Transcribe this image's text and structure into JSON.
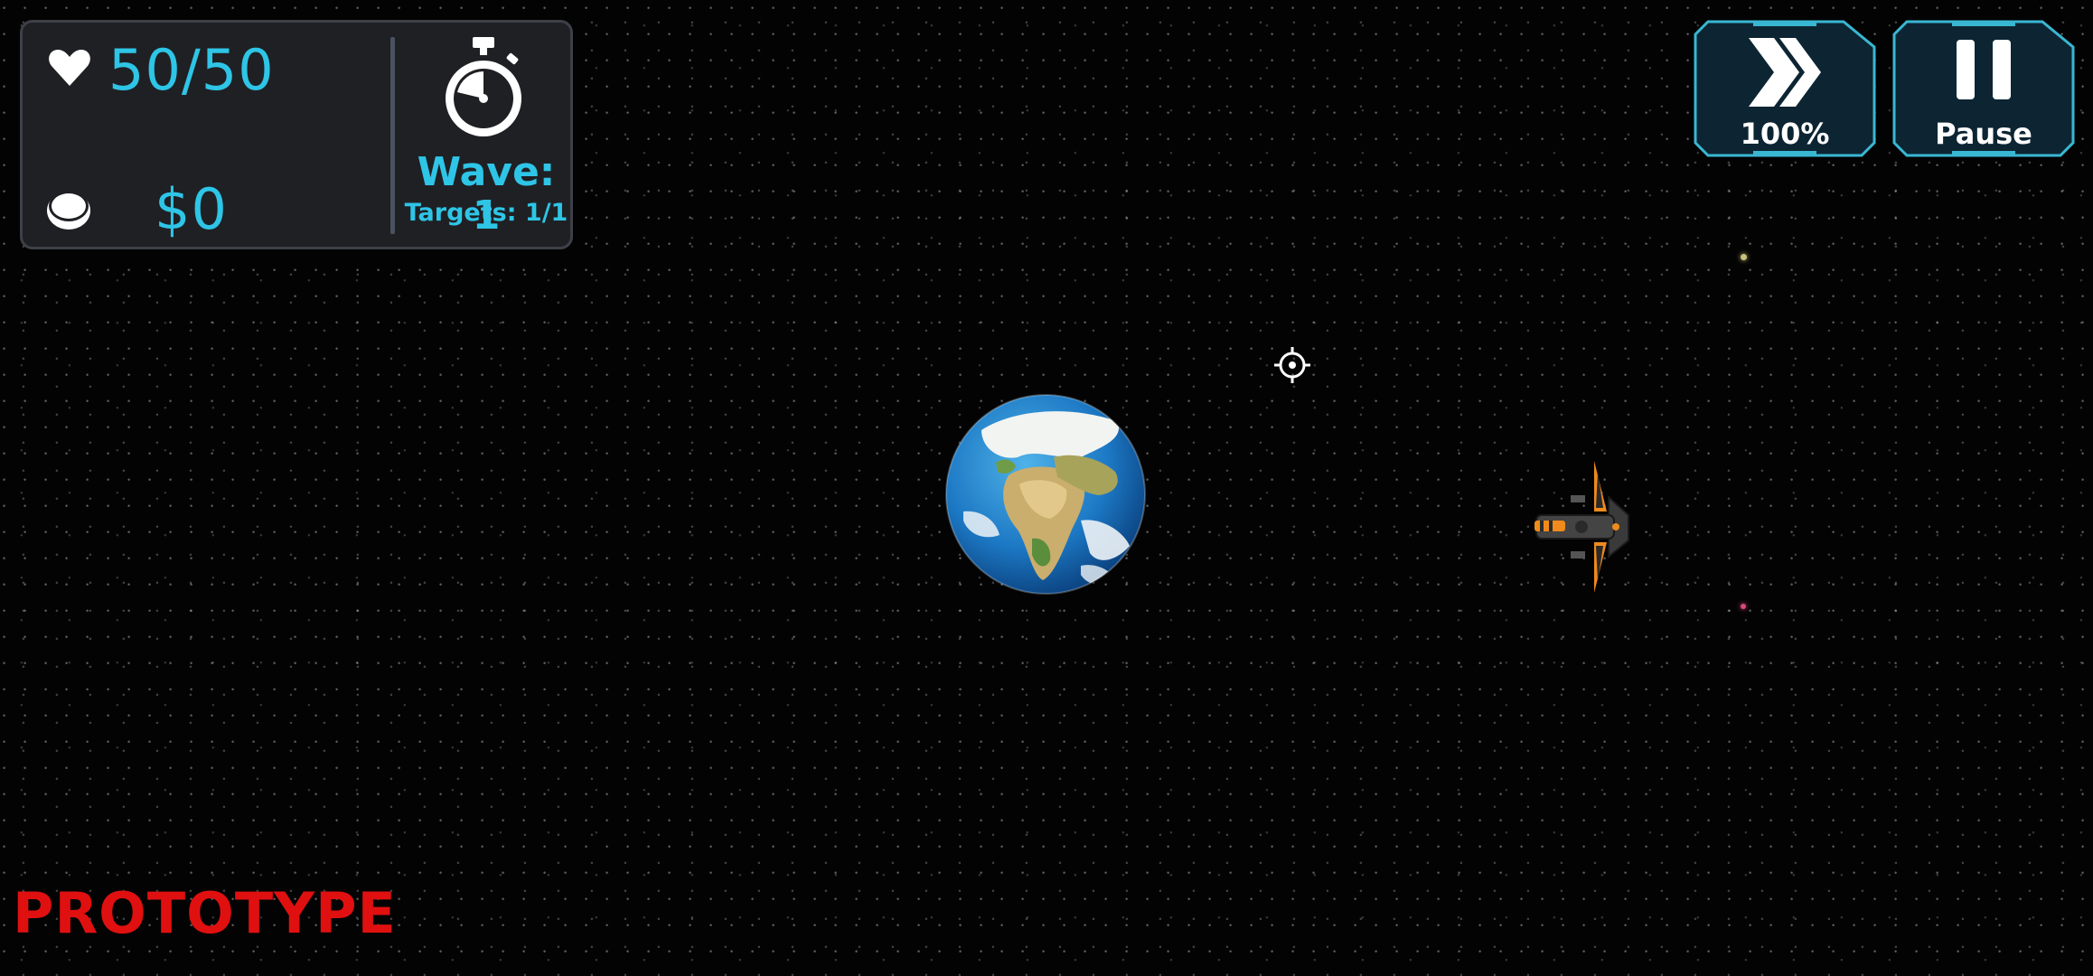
{
  "hud": {
    "health": "50/50",
    "money": "$0",
    "wave": "Wave: 1",
    "targets": "Targets: 1/1"
  },
  "buttons": {
    "speed_label": "100%",
    "pause_label": "Pause"
  },
  "footer": {
    "build_label": "PROTOTYPE"
  },
  "icons": {
    "health": "heart-icon",
    "money": "coin-icon",
    "timer": "stopwatch-icon",
    "speed": "fast-forward-icon",
    "pause": "pause-icon",
    "target": "crosshair-icon"
  },
  "colors": {
    "accent": "#2ec5e6",
    "panel": "#1f2024",
    "button_fill": "#0d2533",
    "button_border": "#39b7d2",
    "warning": "#e01010",
    "ship_accent": "#f08a1c"
  }
}
